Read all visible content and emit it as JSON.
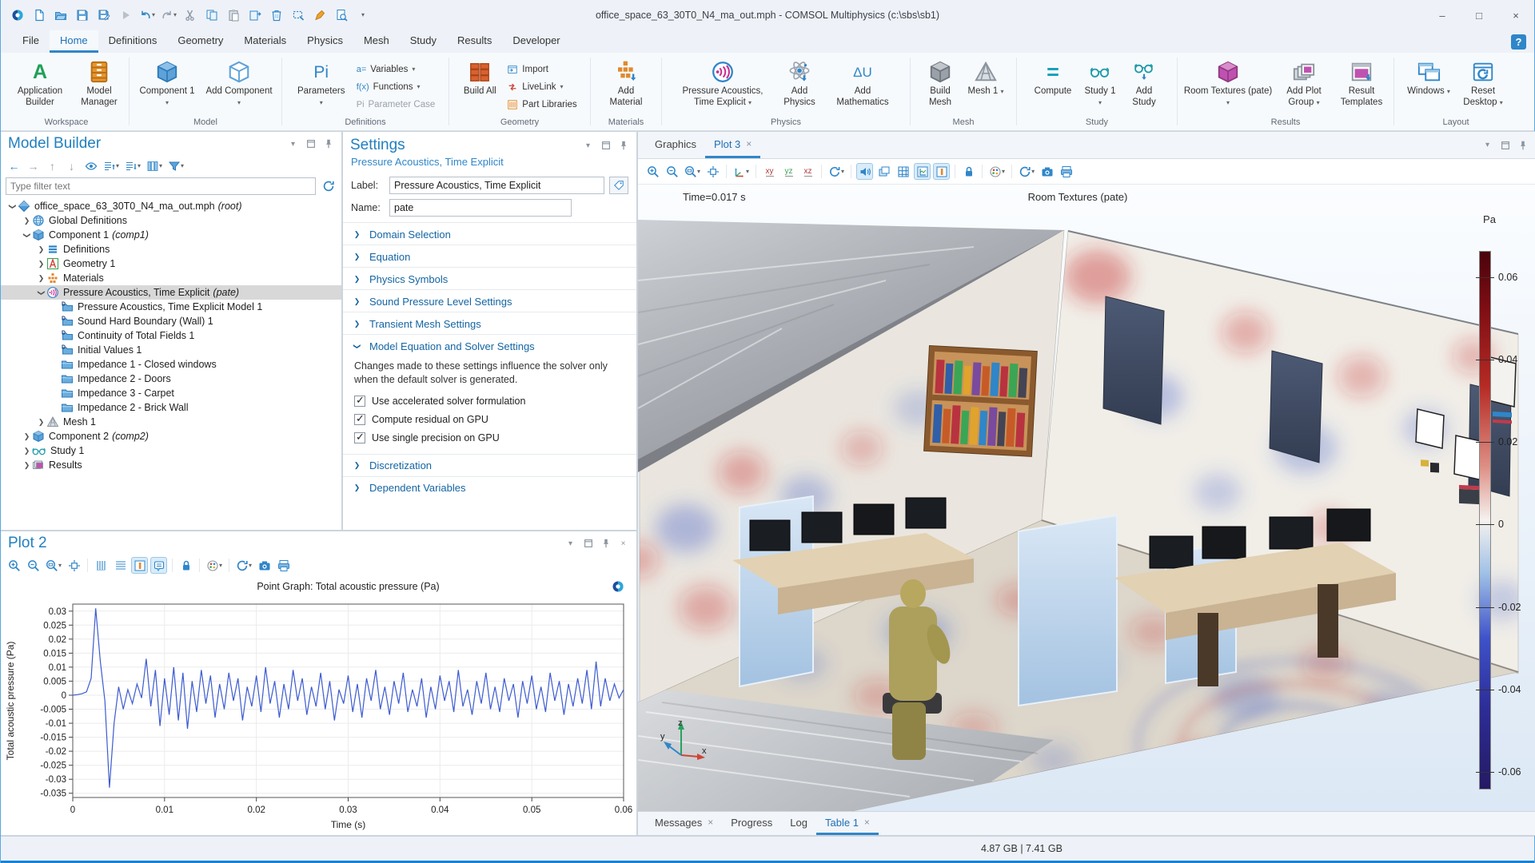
{
  "window": {
    "title": "office_space_63_30T0_N4_ma_out.mph - COMSOL Multiphysics (c:\\sbs\\sb1)",
    "quick_access_icons": [
      "comsol-logo",
      "new-file",
      "open-file",
      "save",
      "save-copy",
      "run",
      "undo",
      "redo",
      "cut",
      "copy",
      "paste",
      "duplicate",
      "delete",
      "select-box",
      "highlighter",
      "preview",
      "customize-toolbar"
    ]
  },
  "icons": {
    "app_builder_glyph": "A",
    "parameters_glyph": "Pi",
    "variables_glyph": "a=",
    "functions_glyph": "f(x)",
    "parameter_case_glyph": "Pi",
    "add_mathematics_glyph": "ΔU",
    "compute_glyph": "=",
    "help_glyph": "?",
    "view_xy": "xy",
    "view_yz": "yz",
    "view_xz": "xz",
    "minimize_glyph": "–",
    "maximize_glyph": "□",
    "close_glyph": "×",
    "caret": "▾",
    "back": "←",
    "forward": "→",
    "up": "↑",
    "down": "↓"
  },
  "menu": {
    "items": [
      "File",
      "Home",
      "Definitions",
      "Geometry",
      "Materials",
      "Physics",
      "Mesh",
      "Study",
      "Results",
      "Developer"
    ],
    "active": "Home"
  },
  "ribbon": {
    "groups": [
      {
        "label": "Workspace",
        "buttons": [
          {
            "label": "Application Builder"
          },
          {
            "label": "Model Manager"
          }
        ]
      },
      {
        "label": "Model",
        "buttons": [
          {
            "label": "Component 1",
            "dropdown": true
          },
          {
            "label": "Add Component",
            "dropdown": true
          }
        ]
      },
      {
        "label": "Definitions",
        "buttons": [
          {
            "label": "Parameters",
            "dropdown": true
          }
        ],
        "stack": [
          {
            "label": "Variables",
            "dropdown": true
          },
          {
            "label": "Functions",
            "dropdown": true
          },
          {
            "label": "Parameter Case",
            "disabled": true
          }
        ]
      },
      {
        "label": "Geometry",
        "buttons": [
          {
            "label": "Build All"
          }
        ],
        "stack": [
          {
            "label": "Import"
          },
          {
            "label": "LiveLink",
            "dropdown": true
          },
          {
            "label": "Part Libraries"
          }
        ]
      },
      {
        "label": "Materials",
        "buttons": [
          {
            "label": "Add Material"
          }
        ]
      },
      {
        "label": "Physics",
        "buttons": [
          {
            "label": "Pressure Acoustics, Time Explicit",
            "dropdown": true
          },
          {
            "label": "Add Physics"
          },
          {
            "label": "Add Mathematics"
          }
        ]
      },
      {
        "label": "Mesh",
        "buttons": [
          {
            "label": "Build Mesh"
          },
          {
            "label": "Mesh 1",
            "dropdown": true
          }
        ]
      },
      {
        "label": "Study",
        "buttons": [
          {
            "label": "Compute"
          },
          {
            "label": "Study 1",
            "dropdown": true
          },
          {
            "label": "Add Study"
          }
        ]
      },
      {
        "label": "Results",
        "buttons": [
          {
            "label": "Room Textures (pate)",
            "dropdown": true
          },
          {
            "label": "Add Plot Group",
            "dropdown": true
          },
          {
            "label": "Result Templates"
          }
        ]
      },
      {
        "label": "Layout",
        "buttons": [
          {
            "label": "Windows",
            "dropdown": true
          },
          {
            "label": "Reset Desktop",
            "dropdown": true
          }
        ]
      }
    ]
  },
  "model_builder": {
    "title": "Model Builder",
    "filter_placeholder": "Type filter text",
    "toolbar_icons": [
      "back",
      "forward",
      "move-up",
      "move-down",
      "show",
      "expand-all",
      "collapse-all",
      "model-tree-node-text",
      "filter"
    ],
    "tree": {
      "items": [
        {
          "label": "office_space_63_30T0_N4_ma_out.mph",
          "suffix": "(root)"
        },
        {
          "label": "Global Definitions",
          "suffix": ""
        },
        {
          "label": "Component 1",
          "suffix": "(comp1)"
        },
        {
          "label": "Definitions",
          "suffix": ""
        },
        {
          "label": "Geometry 1",
          "suffix": ""
        },
        {
          "label": "Materials",
          "suffix": ""
        },
        {
          "label": "Pressure Acoustics, Time Explicit",
          "suffix": "(pate)"
        },
        {
          "label": "Pressure Acoustics, Time Explicit Model 1",
          "suffix": ""
        },
        {
          "label": "Sound Hard Boundary (Wall) 1",
          "suffix": ""
        },
        {
          "label": "Continuity of Total Fields 1",
          "suffix": ""
        },
        {
          "label": "Initial Values 1",
          "suffix": ""
        },
        {
          "label": "Impedance 1 - Closed windows",
          "suffix": ""
        },
        {
          "label": "Impedance 2 - Doors",
          "suffix": ""
        },
        {
          "label": "Impedance 3 - Carpet",
          "suffix": ""
        },
        {
          "label": "Impedance 2 - Brick Wall",
          "suffix": ""
        },
        {
          "label": "Mesh 1",
          "suffix": ""
        },
        {
          "label": "Component 2",
          "suffix": "(comp2)"
        },
        {
          "label": "Study 1",
          "suffix": ""
        },
        {
          "label": "Results",
          "suffix": ""
        }
      ]
    }
  },
  "settings": {
    "title": "Settings",
    "subtitle": "Pressure Acoustics, Time Explicit",
    "label_caption": "Label:",
    "label_value": "Pressure Acoustics, Time Explicit",
    "name_caption": "Name:",
    "name_value": "pate",
    "sections": [
      {
        "label": "Domain Selection"
      },
      {
        "label": "Equation"
      },
      {
        "label": "Physics Symbols"
      },
      {
        "label": "Sound Pressure Level Settings"
      },
      {
        "label": "Transient Mesh Settings"
      },
      {
        "label": "Model Equation and Solver Settings",
        "expanded": true
      },
      {
        "label": "Discretization"
      },
      {
        "label": "Dependent Variables"
      }
    ],
    "solver_note": "Changes made to these settings influence the solver only when the default solver is generated.",
    "checkboxes": [
      {
        "label": "Use accelerated solver formulation",
        "checked": true
      },
      {
        "label": "Compute residual on GPU",
        "checked": true
      },
      {
        "label": "Use single precision on GPU",
        "checked": true
      }
    ]
  },
  "plot2": {
    "title": "Plot 2",
    "toolbar_icons": [
      "zoom-in",
      "zoom-out",
      "zoom-box",
      "zoom-extents",
      "vertical-grid",
      "horizontal-grid",
      "axis-toggle",
      "legend-toggle",
      "lock-axes",
      "color-palette",
      "refresh-plot",
      "snapshot",
      "print"
    ]
  },
  "chart_data": {
    "type": "line",
    "title": "Point Graph: Total acoustic pressure (Pa)",
    "xlabel": "Time (s)",
    "ylabel": "Total acoustic pressure (Pa)",
    "xlim": [
      0,
      0.06
    ],
    "ylim": [
      -0.0365,
      0.0325
    ],
    "x_ticks": [
      0,
      0.01,
      0.02,
      0.03,
      0.04,
      0.05,
      0.06
    ],
    "y_ticks": [
      0.03,
      0.025,
      0.02,
      0.015,
      0.01,
      0.005,
      0,
      -0.005,
      -0.01,
      -0.015,
      -0.02,
      -0.025,
      -0.03,
      -0.035
    ],
    "grid": true,
    "legend": false,
    "line_color": "#3c5bd0",
    "series": [
      {
        "name": "Total acoustic pressure",
        "t_start": 0,
        "t_step": 0.0005,
        "values": [
          0,
          0.0002,
          0.0005,
          0.0012,
          0.006,
          0.031,
          0.012,
          -0.002,
          -0.033,
          -0.01,
          0.003,
          -0.005,
          0.002,
          -0.003,
          0.004,
          -0.001,
          0.013,
          -0.004,
          0.009,
          -0.011,
          0.006,
          -0.007,
          0.01,
          -0.009,
          0.008,
          -0.012,
          0.005,
          -0.006,
          0.009,
          -0.003,
          0.007,
          -0.008,
          0.004,
          -0.005,
          0.008,
          -0.002,
          0.006,
          -0.009,
          0.003,
          -0.004,
          0.007,
          -0.006,
          0.01,
          -0.003,
          0.005,
          -0.008,
          0.004,
          -0.005,
          0.009,
          -0.002,
          0.006,
          -0.007,
          0.003,
          -0.004,
          0.008,
          -0.005,
          0.005,
          -0.009,
          0.002,
          -0.003,
          0.007,
          -0.006,
          0.004,
          -0.008,
          0.006,
          -0.002,
          0.009,
          -0.005,
          0.003,
          -0.007,
          0.005,
          -0.003,
          0.008,
          -0.006,
          0.002,
          -0.004,
          0.006,
          -0.008,
          0.003,
          -0.005,
          0.007,
          -0.002,
          0.005,
          -0.006,
          0.009,
          -0.004,
          0.002,
          -0.007,
          0.005,
          -0.003,
          0.008,
          -0.005,
          0.003,
          -0.006,
          0.006,
          -0.002,
          0.004,
          -0.008,
          0.005,
          -0.003,
          0.007,
          -0.005,
          0.003,
          -0.006,
          0.008,
          -0.002,
          0.005,
          -0.007,
          0.004,
          -0.004,
          0.006,
          -0.003,
          0.009,
          -0.005,
          0.012,
          -0.004,
          0.006,
          -0.002,
          0.004,
          -0.001,
          0.002
        ]
      }
    ]
  },
  "graphics": {
    "tabs": [
      {
        "label": "Graphics",
        "active": false,
        "closable": false
      },
      {
        "label": "Plot 3",
        "active": true,
        "closable": true
      }
    ],
    "toolbar_icons": [
      "zoom-in",
      "zoom-out",
      "zoom-box",
      "zoom-extents",
      "default-view",
      "view-xy",
      "view-yz",
      "view-xz",
      "rotate",
      "sound-toggle",
      "scene-light",
      "grid-toggle",
      "plot-axes-toggle",
      "axis-orientation-toggle",
      "lock-view",
      "color-palette",
      "refresh-plot",
      "snapshot",
      "print"
    ],
    "time_annotation": "Time=0.017 s",
    "plot_annotation": "Room Textures (pate)",
    "colorbar": {
      "unit": "Pa",
      "ticks": [
        "0.06",
        "0.04",
        "0.02",
        "0",
        "-0.02",
        "-0.04",
        "-0.06"
      ],
      "top_color": "#4a030c",
      "zero_color": "#f5f2ef",
      "bottom_color": "#251a63"
    },
    "triad": {
      "x": "x",
      "y": "y",
      "z": "z"
    }
  },
  "bottom_tabs": {
    "tabs": [
      {
        "label": "Messages",
        "closable": true,
        "active": false
      },
      {
        "label": "Progress",
        "closable": false,
        "active": false
      },
      {
        "label": "Log",
        "closable": false,
        "active": false
      },
      {
        "label": "Table 1",
        "closable": true,
        "active": true
      }
    ]
  },
  "status": {
    "memory": "4.87 GB | 7.41 GB"
  }
}
